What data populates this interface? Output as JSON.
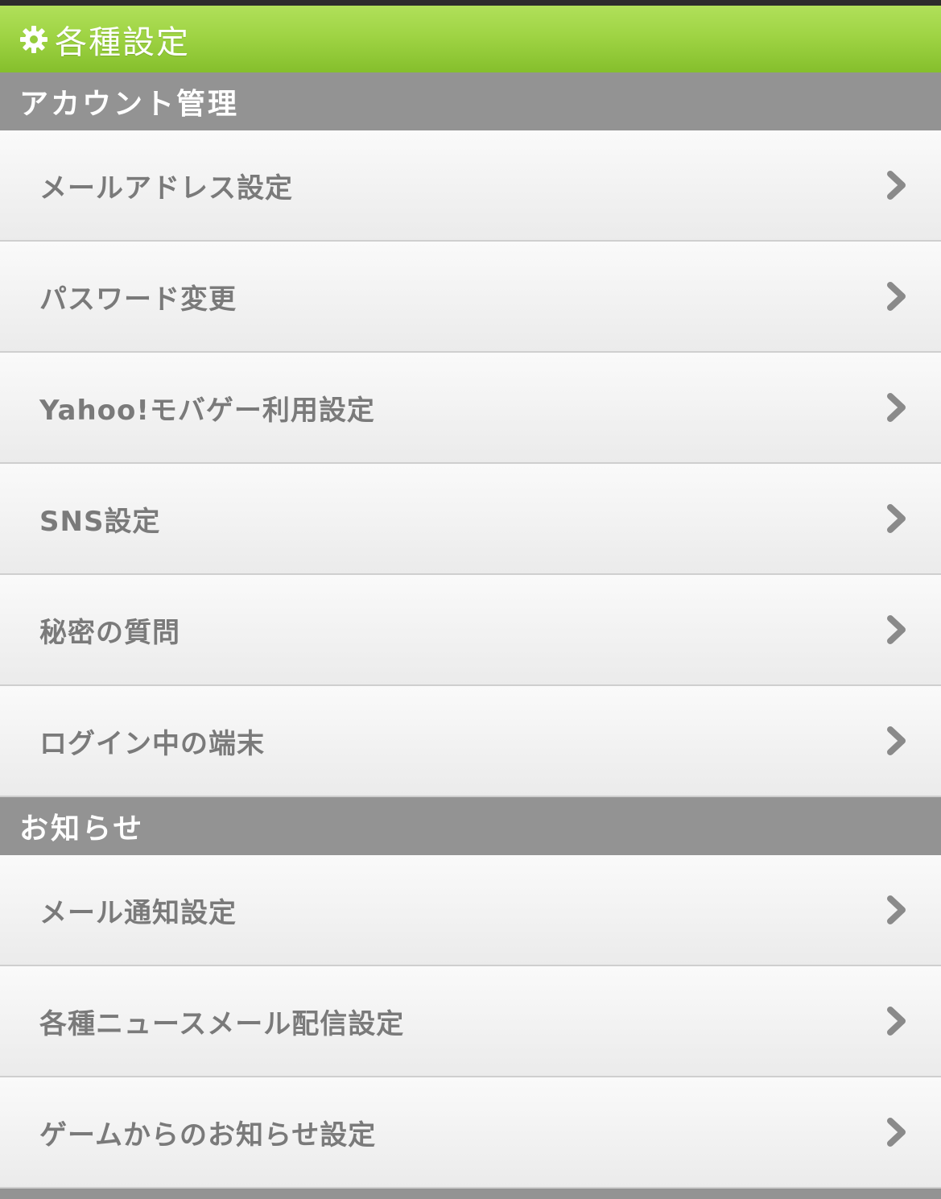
{
  "header": {
    "title": "各種設定",
    "icon": "gear-icon",
    "accent_color": "#9fd444"
  },
  "sections": [
    {
      "title": "アカウント管理",
      "items": [
        {
          "label": "メールアドレス設定"
        },
        {
          "label": "パスワード変更"
        },
        {
          "label": "Yahoo!モバゲー利用設定"
        },
        {
          "label": "SNS設定"
        },
        {
          "label": "秘密の質問"
        },
        {
          "label": "ログイン中の端末"
        }
      ]
    },
    {
      "title": "お知らせ",
      "items": [
        {
          "label": "メール通知設定"
        },
        {
          "label": "各種ニュースメール配信設定"
        },
        {
          "label": "ゲームからのお知らせ設定"
        }
      ]
    }
  ],
  "item_icon": "chevron-right-icon",
  "section_header_color": "#939393"
}
